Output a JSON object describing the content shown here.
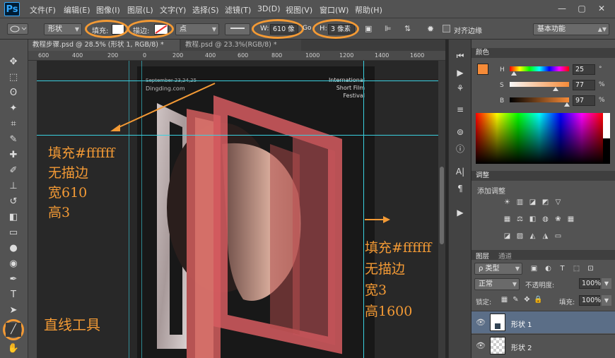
{
  "app": {
    "logo": "Ps",
    "menu": [
      "文件(F)",
      "编辑(E)",
      "图像(I)",
      "图层(L)",
      "文字(Y)",
      "选择(S)",
      "滤镜(T)",
      "3D(D)",
      "视图(V)",
      "窗口(W)",
      "帮助(H)"
    ],
    "window_buttons": [
      "—",
      "▢",
      "✕"
    ]
  },
  "options": {
    "shape_mode": "形状",
    "fill_label": "填充:",
    "stroke_label": "描边:",
    "stroke_unit": "点",
    "width_label": "W:",
    "width_value": "610 像",
    "link_label": "Go",
    "height_label": "H:",
    "height_value": "3 像素",
    "align_edges_label": "对齐边缘",
    "workspace": "基本功能"
  },
  "tabs": [
    {
      "label": "教程步骤.psd @ 28.5% (形状 1, RGB/8) *",
      "active": true
    },
    {
      "label": "教程.psd @ 23.3%(RGB/8) *",
      "active": false
    }
  ],
  "ruler_ticks": [
    "600",
    "400",
    "200",
    "0",
    "200",
    "400",
    "600",
    "800",
    "1000",
    "1200",
    "1400",
    "1600"
  ],
  "poster": {
    "date_line": "September 23,24,25",
    "site": "Dingding.com",
    "festival": [
      "International",
      "Short Film",
      "Festival"
    ]
  },
  "annotations": {
    "left": [
      "填充#ffffff",
      "无描边",
      "宽610",
      "高3"
    ],
    "right": [
      "填充#ffffff",
      "无描边",
      "宽3",
      "高1600"
    ],
    "tool": "直线工具"
  },
  "color_panel": {
    "title": "颜色",
    "channels": [
      {
        "label": "H",
        "value": "25",
        "unit": "°",
        "level": 0.07
      },
      {
        "label": "S",
        "value": "77",
        "unit": "%",
        "level": 0.77
      },
      {
        "label": "B",
        "value": "97",
        "unit": "%",
        "level": 0.97
      }
    ],
    "foreground": "#f68b38",
    "background": "#ffffff"
  },
  "adjust_panel": {
    "title": "调整",
    "add_label": "添加调整"
  },
  "layers_panel": {
    "tabs": [
      "图层",
      "通道"
    ],
    "filter_kind": "ρ 类型",
    "blend_mode": "正常",
    "opacity_label": "不透明度:",
    "opacity_value": "100%",
    "lock_label": "锁定:",
    "fill_label": "填充:",
    "fill_value": "100%",
    "layers": [
      {
        "name": "形状 1",
        "selected": true
      },
      {
        "name": "形状 2",
        "selected": false
      }
    ]
  },
  "colors": {
    "accent": "#f39a35",
    "guide": "#3ad0e0",
    "ui_bg": "#535353"
  }
}
